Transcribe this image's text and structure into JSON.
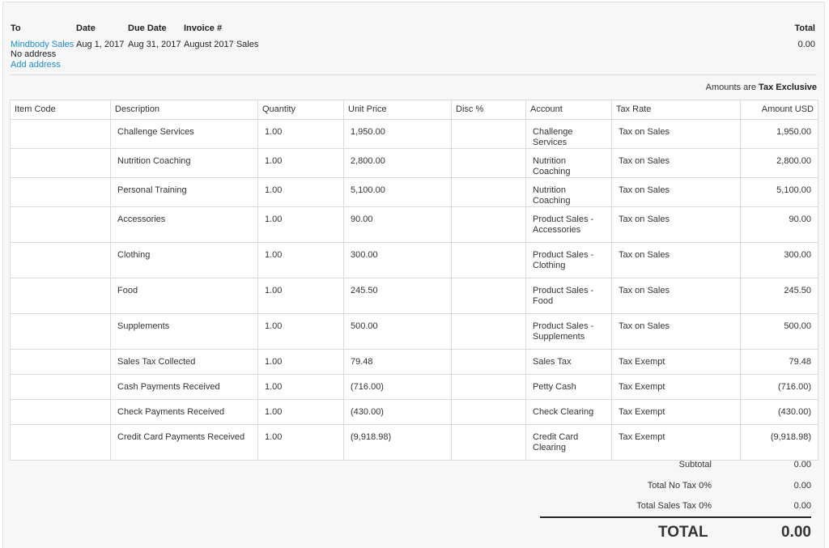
{
  "header": {
    "to_label": "To",
    "date_label": "Date",
    "due_date_label": "Due Date",
    "invoice_label": "Invoice #",
    "total_label": "Total",
    "to_value": "Mindbody Sales",
    "address_value": "No address",
    "add_address": "Add address",
    "date_value": "Aug 1, 2017",
    "due_date_value": "Aug 31, 2017",
    "invoice_value": "August 2017 Sales",
    "total_value": "0.00"
  },
  "amounts_note": {
    "prefix": "Amounts are",
    "value": "Tax Exclusive"
  },
  "table": {
    "columns": [
      "Item Code",
      "Description",
      "Quantity",
      "Unit Price",
      "Disc %",
      "Account",
      "Tax Rate",
      "Amount USD"
    ],
    "rows": [
      {
        "item_code": "",
        "description": "Challenge Services",
        "quantity": "1.00",
        "unit_price": "1,950.00",
        "disc": "",
        "account": "Challenge Services",
        "tax_rate": "Tax on Sales",
        "amount": "1,950.00"
      },
      {
        "item_code": "",
        "description": "Nutrition Coaching",
        "quantity": "1.00",
        "unit_price": "2,800.00",
        "disc": "",
        "account": "Nutrition Coaching",
        "tax_rate": "Tax on Sales",
        "amount": "2,800.00"
      },
      {
        "item_code": "",
        "description": "Personal Training",
        "quantity": "1.00",
        "unit_price": "5,100.00",
        "disc": "",
        "account": "Nutrition Coaching",
        "tax_rate": "Tax on Sales",
        "amount": "5,100.00"
      },
      {
        "item_code": "",
        "description": "Accessories",
        "quantity": "1.00",
        "unit_price": "90.00",
        "disc": "",
        "account": "Product Sales - Accessories",
        "tax_rate": "Tax on Sales",
        "amount": "90.00"
      },
      {
        "item_code": "",
        "description": "Clothing",
        "quantity": "1.00",
        "unit_price": "300.00",
        "disc": "",
        "account": "Product Sales - Clothing",
        "tax_rate": "Tax on Sales",
        "amount": "300.00"
      },
      {
        "item_code": "",
        "description": "Food",
        "quantity": "1.00",
        "unit_price": "245.50",
        "disc": "",
        "account": "Product Sales - Food",
        "tax_rate": "Tax on Sales",
        "amount": "245.50"
      },
      {
        "item_code": "",
        "description": "Supplements",
        "quantity": "1.00",
        "unit_price": "500.00",
        "disc": "",
        "account": "Product Sales - Supplements",
        "tax_rate": "Tax on Sales",
        "amount": "500.00"
      },
      {
        "item_code": "",
        "description": "Sales Tax Collected",
        "quantity": "1.00",
        "unit_price": "79.48",
        "disc": "",
        "account": "Sales Tax",
        "tax_rate": "Tax Exempt",
        "amount": "79.48"
      },
      {
        "item_code": "",
        "description": "Cash Payments Received",
        "quantity": "1.00",
        "unit_price": "(716.00)",
        "disc": "",
        "account": "Petty Cash",
        "tax_rate": "Tax Exempt",
        "amount": "(716.00)"
      },
      {
        "item_code": "",
        "description": "Check Payments Received",
        "quantity": "1.00",
        "unit_price": "(430.00)",
        "disc": "",
        "account": "Check Clearing",
        "tax_rate": "Tax Exempt",
        "amount": "(430.00)"
      },
      {
        "item_code": "",
        "description": "Credit Card Payments Received",
        "quantity": "1.00",
        "unit_price": "(9,918.98)",
        "disc": "",
        "account": "Credit Card Clearing",
        "tax_rate": "Tax Exempt",
        "amount": "(9,918.98)"
      }
    ]
  },
  "totals": {
    "subtotal_label": "Subtotal",
    "subtotal_value": "0.00",
    "no_tax_label": "Total No Tax 0%",
    "no_tax_value": "0.00",
    "sales_tax_label": "Total Sales Tax 0%",
    "sales_tax_value": "0.00",
    "total_label": "TOTAL",
    "total_value": "0.00"
  }
}
